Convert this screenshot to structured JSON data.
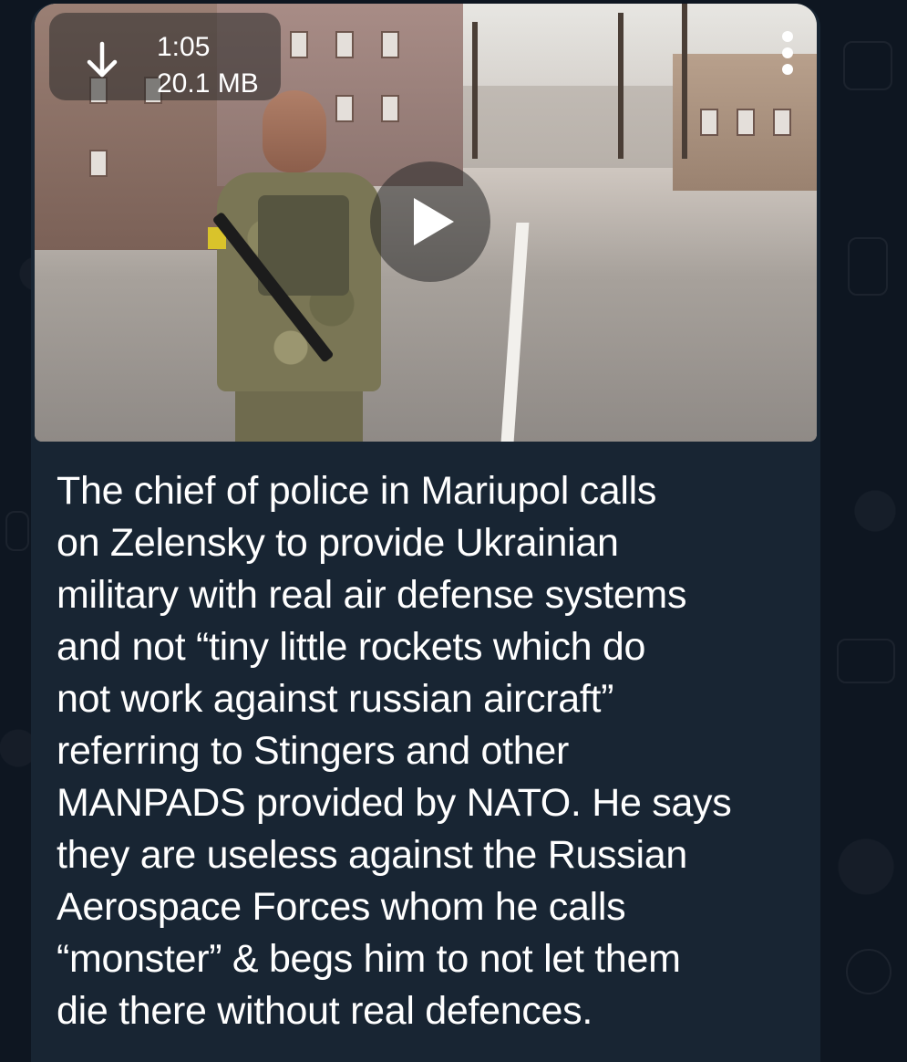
{
  "message": {
    "video": {
      "duration": "1:05",
      "file_size": "20.1 MB",
      "download_icon": "download-arrow-icon",
      "play_icon": "play-icon"
    },
    "menu_icon": "more-vertical-icon",
    "caption": "The chief of police in Mariupol calls\non Zelensky to provide Ukrainian\nmilitary with real air defense systems\nand not “tiny little rockets which do\nnot work against russian aircraft”\nreferring to Stingers and other\nMANPADS provided by NATO. He says\nthey are useless against the Russian\nAerospace Forces whom he calls\n“monster” & begs him to not let them\ndie there without real defences."
  },
  "colors": {
    "chat_background": "#0e1621",
    "bubble_background": "#182533",
    "text": "#ffffff"
  }
}
